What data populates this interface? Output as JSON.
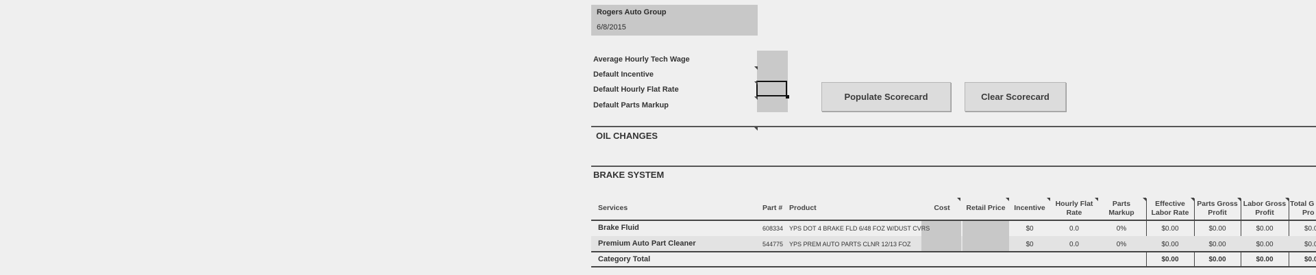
{
  "header": {
    "company": "Rogers Auto Group",
    "date": "6/8/2015"
  },
  "defaults": {
    "wage_label": "Average Hourly Tech Wage",
    "incentive_label": "Default Incentive",
    "flat_rate_label": "Default Hourly Flat Rate",
    "markup_label": "Default Parts Markup"
  },
  "buttons": {
    "populate": "Populate Scorecard",
    "clear": "Clear Scorecard"
  },
  "sections": {
    "oil": "OIL CHANGES",
    "brake": "BRAKE SYSTEM"
  },
  "table": {
    "headers": {
      "services": "Services",
      "part": "Part #",
      "product": "Product",
      "cost": "Cost",
      "retail": "Retail Price",
      "incentive": "Incentive",
      "flat1": "Hourly Flat",
      "flat2": "Rate",
      "markup1": "Parts",
      "markup2": "Markup",
      "elr1": "Effective",
      "elr2": "Labor Rate",
      "pgp1": "Parts Gross",
      "pgp2": "Profit",
      "lgp1": "Labor Gross",
      "lgp2": "Profit",
      "tgp1": "Total G",
      "tgp2": "Pro"
    },
    "rows": [
      {
        "service": "Brake Fluid",
        "part": "608334",
        "product": "YPS DOT 4 BRAKE FLD 6/48 FOZ W/DUST CVRS",
        "incentive": "$0",
        "flat": "0.0",
        "markup": "0%",
        "elr": "$0.00",
        "pgp": "$0.00",
        "lgp": "$0.00",
        "tgp": "$0.0"
      },
      {
        "service": "Premium Auto Part Cleaner",
        "part": "544775",
        "product": "YPS PREM AUTO PARTS CLNR 12/13 FOZ",
        "incentive": "$0",
        "flat": "0.0",
        "markup": "0%",
        "elr": "$0.00",
        "pgp": "$0.00",
        "lgp": "$0.00",
        "tgp": "$0.0"
      }
    ],
    "total": {
      "label": "Category Total",
      "elr": "$0.00",
      "pgp": "$0.00",
      "lgp": "$0.00",
      "tgp": "$0.0"
    }
  }
}
